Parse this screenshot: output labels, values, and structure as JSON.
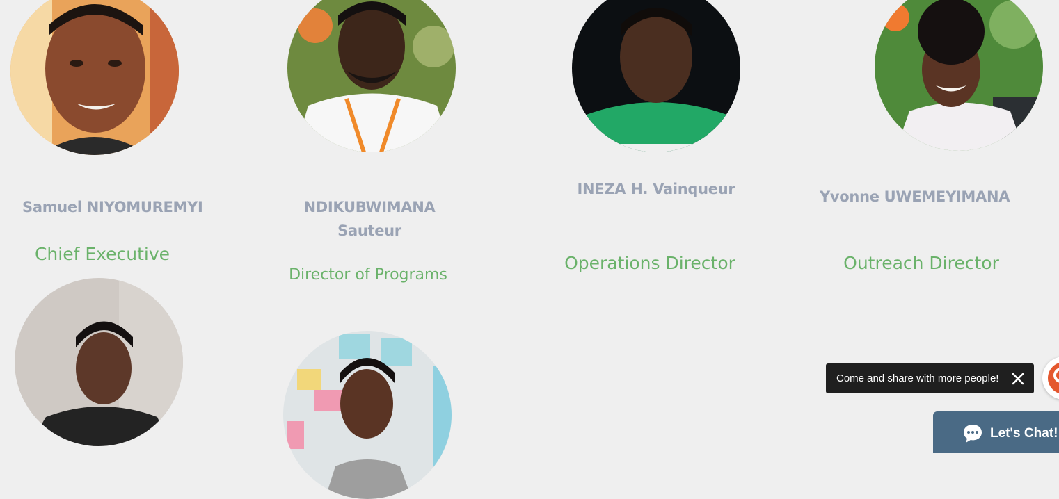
{
  "team": [
    {
      "name": "Samuel NIYOMUREMYI",
      "role": "Chief Executive"
    },
    {
      "name_line1": "NDIKUBWIMANA",
      "name_line2": "Sauteur",
      "role": "Director of Programs"
    },
    {
      "name": "INEZA H. Vainqueur",
      "role": "Operations Director"
    },
    {
      "name": "Yvonne UWEMEYIMANA",
      "role": "Outreach Director"
    }
  ],
  "toast": {
    "message": "Come and share with more people!",
    "close_icon": "close-icon"
  },
  "chat": {
    "label": "Let's Chat!",
    "icon": "chat-bubble-icon"
  },
  "colors": {
    "background": "#efefef",
    "name_text": "#9aa3b4",
    "role_text": "#6ab26a",
    "chat_button": "#4a6a85",
    "toast_background": "#1f1f1f",
    "share_accent": "#e4572e"
  }
}
